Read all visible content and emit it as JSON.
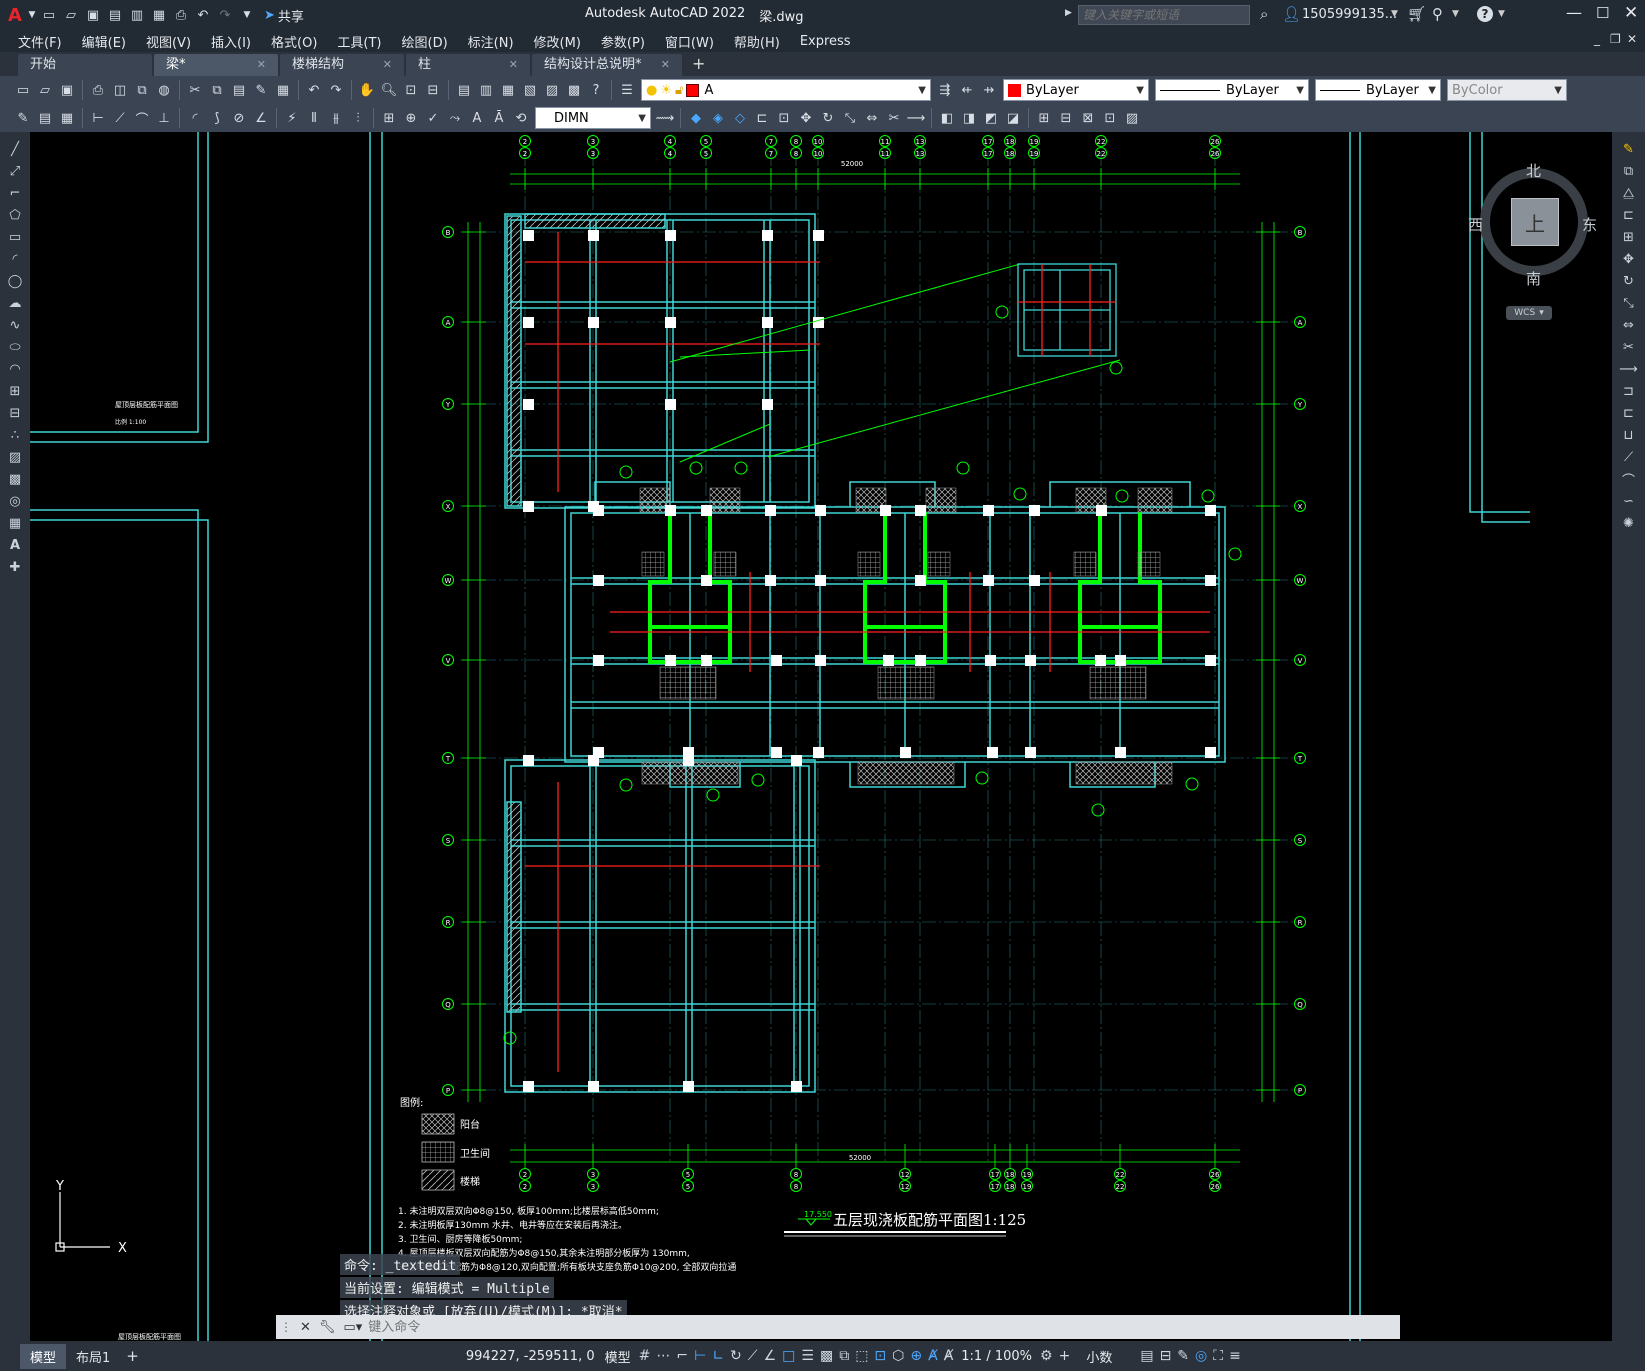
{
  "app": {
    "title": "Autodesk AutoCAD 2022",
    "file": "梁.dwg",
    "search_placeholder": "键入关键字或短语",
    "user": "1505999135...",
    "share": "共享"
  },
  "menu": [
    "文件(F)",
    "编辑(E)",
    "视图(V)",
    "插入(I)",
    "格式(O)",
    "工具(T)",
    "绘图(D)",
    "标注(N)",
    "修改(M)",
    "参数(P)",
    "窗口(W)",
    "帮助(H)",
    "Express"
  ],
  "tabs": [
    {
      "label": "开始",
      "active": false
    },
    {
      "label": "梁*",
      "active": true
    },
    {
      "label": "楼梯结构",
      "active": false
    },
    {
      "label": "柱",
      "active": false
    },
    {
      "label": "结构设计总说明*",
      "active": false
    }
  ],
  "toolbar": {
    "layer": "A",
    "color": "ByLayer",
    "linetype": "ByLayer",
    "lineweight": "ByLayer",
    "plotstyle": "ByColor",
    "dimstyle": "DIMN"
  },
  "viewcube": {
    "north": "北",
    "south": "南",
    "east": "东",
    "west": "西",
    "top": "上",
    "wcs": "WCS"
  },
  "drawing": {
    "title": "五层现浇板配筋平面图1:125",
    "level": "17.550",
    "overall_dim": "52000",
    "left_sheet_title": "屋顶层板配筋平面图",
    "left_sheet_scale": "比例 1:100",
    "left_sheet_bottom": "屋顶层板配筋平面图",
    "legend_title": "图例:",
    "legend": [
      "阳台",
      "卫生间",
      "楼梯"
    ],
    "row_labels": [
      "B",
      "A",
      "Y",
      "X",
      "W",
      "V",
      "T",
      "S",
      "R",
      "Q",
      "P"
    ],
    "col_labels_top": [
      "2",
      "3",
      "4",
      "5",
      "7",
      "8",
      "10",
      "11",
      "13",
      "17",
      "18",
      "19",
      "22",
      "26"
    ],
    "col_labels_bottom": [
      "2",
      "3",
      "5",
      "8",
      "12",
      "17",
      "18",
      "19",
      "22",
      "26"
    ],
    "note_lines": [
      "1. 未注明双层双向Φ8@150, 板厚100mm;比楼层标高低50mm;",
      "2. 未注明板厚130mm  水井、电井等应在安装后再浇注。",
      "3. 卫生间、厨房等降板50mm;",
      "4. 屋顶层楼板双层双向配筋为Φ8@150,其余未注明部分板厚为 130mm,",
      "   未注明板底板配筋为Φ8@120,双向配置;所有板块支座负筋Φ10@200, 全部双向拉通"
    ]
  },
  "command": {
    "history": [
      "命令: _textedit",
      "当前设置: 编辑模式 = Multiple",
      "选择注释对象或 [放弃(U)/模式(M)]: *取消*"
    ],
    "placeholder": "键入命令"
  },
  "status": {
    "layout_tabs": [
      "模型",
      "布局1"
    ],
    "coords": "994227, -259511, 0",
    "space": "模型",
    "scale": "1:1 / 100%",
    "units": "小数"
  },
  "colors": {
    "cyan": "#3fd6d6",
    "green": "#00ff00",
    "red": "#ff2020",
    "white": "#ffffff",
    "ui_bg": "#222a33"
  }
}
